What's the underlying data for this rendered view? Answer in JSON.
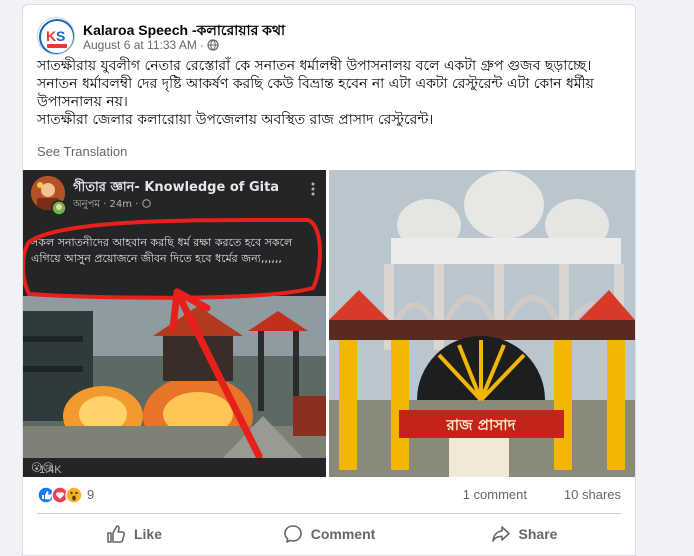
{
  "post": {
    "page_name": "Kalaroa Speech -কলারোয়ার কথা",
    "timestamp": "August 6 at 11:33 AM",
    "dot": "·",
    "privacy_icon": "globe-icon",
    "text_lines": [
      "সাতক্ষীরায় যুবলীগ নেতার রেস্তোরাঁ কে সনাতন ধর্মালম্বী উপাসনালয় বলে একটা গ্রুপ গুজব ছড়াচ্ছে।",
      "সনাতন ধর্মাবলম্বী দের দৃষ্টি আকর্ষণ করছি কেউ বিভ্রান্ত হবেন না এটা একটা রেস্টুরেন্ট এটা কোন ধর্মীয় উপাসনালয় নয়।",
      "সাতক্ষীরা জেলার কলারোয়া উপজেলায় অবস্থিত রাজ প্রাসাদ রেস্টুরেন্ট।"
    ],
    "see_translation": "See Translation"
  },
  "left_image": {
    "inner_page_name": "গীতার জ্ঞান- Knowledge of Gita",
    "inner_meta": "অনুপম · 24m · ",
    "inner_text": "সকল সনাতনীদের আহবান করছি ধর্ম রক্ষা করতে হবে সকলে এগিয়ে আসুন প্রয়োজনে জীবন দিতে হবে ধর্মের জন্য,,,,,,",
    "inner_reactions": "1.4K"
  },
  "right_image": {
    "sign_text": "রাজ প্রাসাদ"
  },
  "stats": {
    "reaction_count": "9",
    "comments": "1 comment",
    "shares": "10 shares"
  },
  "actions": {
    "like": "Like",
    "comment": "Comment",
    "share": "Share"
  },
  "colors": {
    "accent": "#1877f2",
    "secondary_text": "#65676b",
    "annotation_red": "#e8201c"
  }
}
